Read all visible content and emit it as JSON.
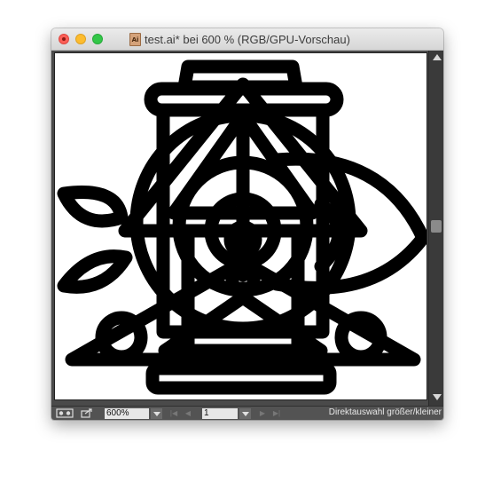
{
  "window": {
    "title": "test.ai* bei 600 % (RGB/GPU-Vorschau)",
    "doc_icon_label": "Ai"
  },
  "canvas": {
    "artwork": "illustrator-line-icon-artwork",
    "stroke_color": "#000000",
    "artboard_color": "#ffffff"
  },
  "statusbar": {
    "zoom_value": "600%",
    "page_value": "1",
    "status_text": "Direktauswahl größer/kleiner"
  },
  "colors": {
    "close": "#fc5f57",
    "minimize": "#fdbc2e",
    "maximize": "#33c748",
    "pasteboard": "#4a4a4a",
    "statusbar": "#535353"
  }
}
